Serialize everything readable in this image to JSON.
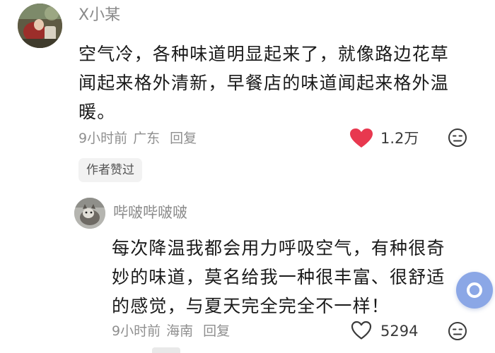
{
  "main_comment": {
    "username": "X小某",
    "text_lines": [
      "空气冷，各种味道明显起来了，就像路边花草",
      "闻起来格外清新，早餐店的味道闻起来格外温",
      "暖。"
    ],
    "time": "9小时前",
    "location": "广东",
    "reply_label": "回复",
    "like_count": "1.2万",
    "liked": true,
    "like_color": "#e8384f",
    "author_badge": "作者赞过",
    "avatar_icon": "avatar-photo-icon",
    "emoji_icon": "dislike-face-icon"
  },
  "reply_comment": {
    "username": "哔啵哔啵啵",
    "text_lines": [
      "每次降温我都会用力呼吸空气，有种很奇",
      "妙的味道，莫名给我一种很丰富、很舒适",
      "的感觉，与夏天完全完全不一样！"
    ],
    "time": "9小时前",
    "location": "海南",
    "reply_label": "回复",
    "like_count": "5294",
    "liked": false,
    "avatar_icon": "avatar-cat-icon",
    "emoji_icon": "dislike-face-icon"
  },
  "floating_button": {
    "icon": "circle-ring-icon",
    "color": "#8ba7e6"
  }
}
